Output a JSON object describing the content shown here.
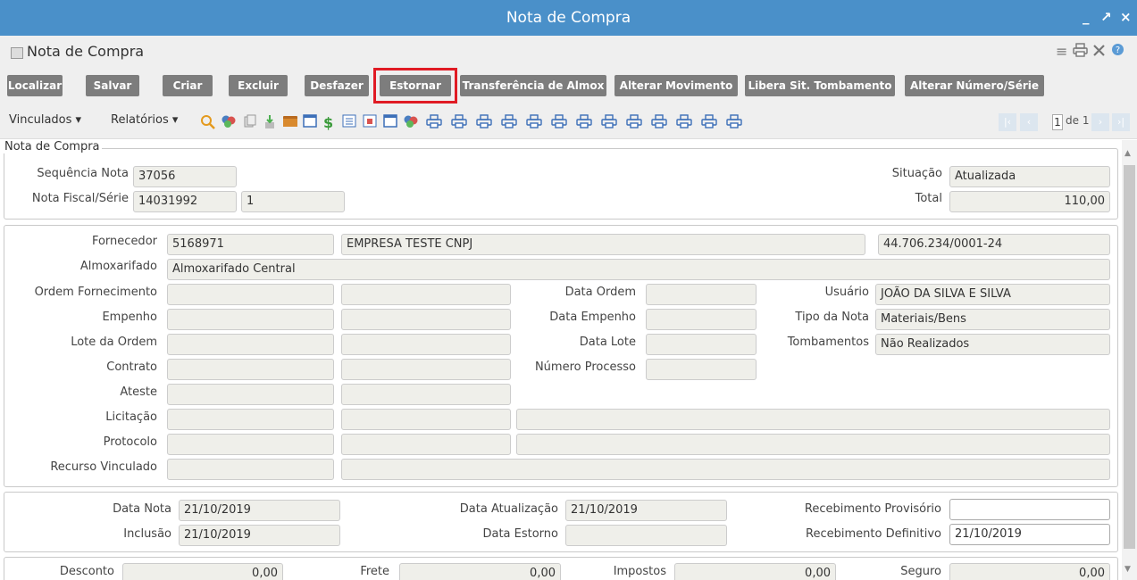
{
  "window": {
    "title": "Nota de Compra",
    "controls": [
      "_",
      "↗",
      "×"
    ]
  },
  "subheader": {
    "title": "Nota de Compra",
    "icons": [
      "menu-icon",
      "print-icon",
      "tools-icon",
      "help-icon"
    ]
  },
  "buttons": [
    "Localizar",
    "Salvar",
    "Criar",
    "Excluir",
    "Desfazer",
    "Estornar",
    "Transferência de Almox",
    "Alterar Movimento",
    "Libera Sit. Tombamento",
    "Alterar Número/Série"
  ],
  "toolbar": {
    "vinculados": "Vinculados ▾",
    "relatorios": "Relatórios ▾",
    "pager": {
      "current": "1",
      "of_label": "de 1"
    }
  },
  "nota": {
    "legend": "Nota de Compra",
    "sequencia_label": "Sequência Nota",
    "sequencia_value": "37056",
    "nf_label": "Nota Fiscal/Série",
    "nf_value": "14031992",
    "serie_value": "1",
    "situacao_label": "Situação",
    "situacao_value": "Atualizada",
    "total_label": "Total",
    "total_value": "110,00"
  },
  "details": {
    "fornecedor_label": "Fornecedor",
    "fornecedor_code": "5168971",
    "fornecedor_name": "EMPRESA TESTE CNPJ",
    "fornecedor_cnpj": "44.706.234/0001-24",
    "almox_label": "Almoxarifado",
    "almox_value": "Almoxarifado Central",
    "ordem_label": "Ordem Fornecimento",
    "data_ordem_label": "Data Ordem",
    "usuario_label": "Usuário",
    "usuario_value": "JOÃO DA SILVA E SILVA",
    "empenho_label": "Empenho",
    "data_empenho_label": "Data Empenho",
    "tipo_nota_label": "Tipo da Nota",
    "tipo_nota_value": "Materiais/Bens",
    "lote_label": "Lote da Ordem",
    "data_lote_label": "Data Lote",
    "tombamentos_label": "Tombamentos",
    "tombamentos_value": "Não Realizados",
    "contrato_label": "Contrato",
    "numero_processo_label": "Número Processo",
    "ateste_label": "Ateste",
    "licitacao_label": "Licitação",
    "protocolo_label": "Protocolo",
    "recurso_label": "Recurso Vinculado"
  },
  "datas": {
    "data_nota_label": "Data Nota",
    "data_nota_value": "21/10/2019",
    "inclusao_label": "Inclusão",
    "inclusao_value": "21/10/2019",
    "data_atualizacao_label": "Data Atualização",
    "data_atualizacao_value": "21/10/2019",
    "data_estorno_label": "Data Estorno",
    "receb_prov_label": "Recebimento Provisório",
    "receb_def_label": "Recebimento Definitivo",
    "receb_def_value": "21/10/2019"
  },
  "valores": {
    "desconto_label": "Desconto",
    "desconto_value": "0,00",
    "frete_label": "Frete",
    "frete_value": "0,00",
    "impostos_label": "Impostos",
    "impostos_value": "0,00",
    "seguro_label": "Seguro",
    "seguro_value": "0,00"
  },
  "colors": {
    "titlebar": "#4a90c9",
    "button": "#7d7d7d",
    "highlight": "#e01b24",
    "field": "#efefea"
  }
}
